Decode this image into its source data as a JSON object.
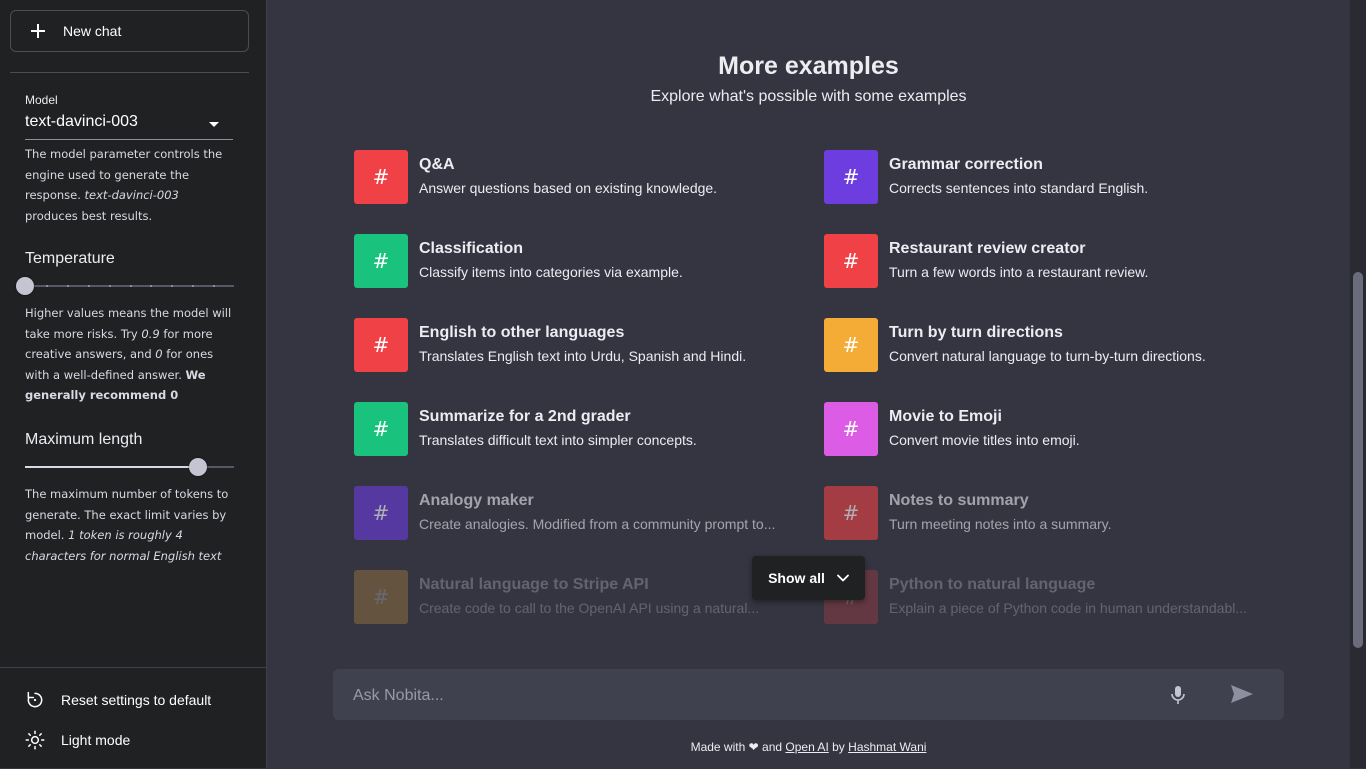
{
  "sidebar": {
    "new_chat_label": "New chat",
    "model": {
      "label": "Model",
      "selected": "text-davinci-003",
      "help_line1": "The model parameter controls the engine used to generate the response.",
      "help_code": "text-davinci-003",
      "help_line2": "produces best results."
    },
    "temperature": {
      "label": "Temperature",
      "value_fraction": 0.0,
      "help_a": "Higher values means the model will take more risks. Try",
      "help_b": "0.9",
      "help_c": "for more creative answers, and",
      "help_d": "0",
      "help_e": "for ones with a well-defined answer.",
      "help_f": "We generally recommend 0"
    },
    "max_length": {
      "label": "Maximum length",
      "value_fraction": 0.83,
      "help_a": "The maximum number of tokens to generate. The exact limit varies by model.",
      "help_b": "1 token is roughly 4 characters for normal English text"
    },
    "reset_label": "Reset settings to default",
    "light_mode_label": "Light mode"
  },
  "main": {
    "title": "More examples",
    "subtitle": "Explore what's possible with some examples",
    "examples": [
      {
        "title": "Q&A",
        "desc": "Answer questions based on existing knowledge.",
        "color": "#ef4146"
      },
      {
        "title": "Grammar correction",
        "desc": "Corrects sentences into standard English.",
        "color": "#6e3de0"
      },
      {
        "title": "Classification",
        "desc": "Classify items into categories via example.",
        "color": "#19c37d"
      },
      {
        "title": "Restaurant review creator",
        "desc": "Turn a few words into a restaurant review.",
        "color": "#ef4146"
      },
      {
        "title": "English to other languages",
        "desc": "Translates English text into Urdu, Spanish and Hindi.",
        "color": "#ef4146"
      },
      {
        "title": "Turn by turn directions",
        "desc": "Convert natural language to turn-by-turn directions.",
        "color": "#f4ac36"
      },
      {
        "title": "Summarize for a 2nd grader",
        "desc": "Translates difficult text into simpler concepts.",
        "color": "#19c37d"
      },
      {
        "title": "Movie to Emoji",
        "desc": "Convert movie titles into emoji.",
        "color": "#dd5ce5"
      },
      {
        "title": "Analogy maker",
        "desc": "Create analogies. Modified from a community prompt to...",
        "color": "#6e3de0"
      },
      {
        "title": "Notes to summary",
        "desc": "Turn meeting notes into a summary.",
        "color": "#ef4146"
      },
      {
        "title": "Natural language to Stripe API",
        "desc": "Create code to call to the OpenAI API using a natural...",
        "color": "#f4ac36"
      },
      {
        "title": "Python to natural language",
        "desc": "Explain a piece of Python code in human understandabl...",
        "color": "#ef4146"
      }
    ],
    "show_all_label": "Show all",
    "icon_glyph": "#",
    "input_placeholder": "Ask Nobita...",
    "footer": {
      "made_with": "Made with",
      "heart": "❤",
      "and": "and",
      "openai": "Open AI",
      "by": "by",
      "author": "Hashmat Wani"
    }
  },
  "colors": {
    "sidebar_bg": "#202123",
    "main_bg": "#343541",
    "input_bg": "#40414f"
  }
}
